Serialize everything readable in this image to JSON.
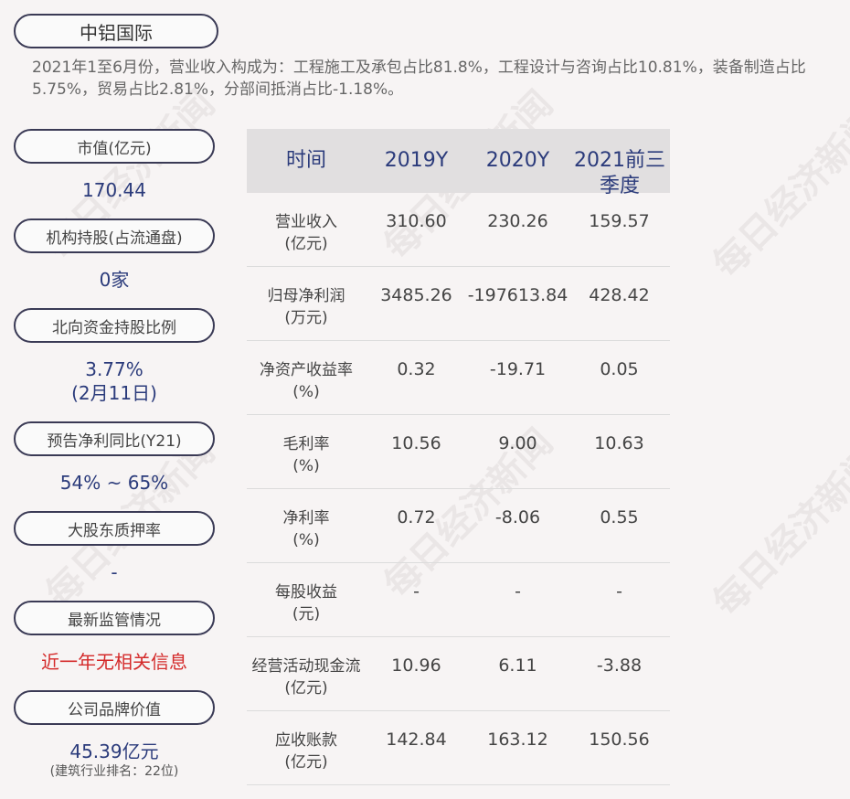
{
  "title": "中铝国际",
  "summary": "2021年1至6月份，营业收入构成为：工程施工及承包占比81.8%，工程设计与咨询占比10.81%，装备制造占比5.75%，贸易占比2.81%，分部间抵消占比-1.18%。",
  "side": {
    "market_cap_label": "市值(亿元)",
    "market_cap_value": "170.44",
    "institution_label": "机构持股(占流通盘)",
    "institution_value": "0家",
    "northbound_label": "北向资金持股比例",
    "northbound_value": "3.77%",
    "northbound_date": "(2月11日)",
    "forecast_label": "预告净利同比(Y21)",
    "forecast_value": "54% ~ 65%",
    "pledge_label": "大股东质押率",
    "pledge_value": "-",
    "regulation_label": "最新监管情况",
    "regulation_value": "近一年无相关信息",
    "brand_label": "公司品牌价值",
    "brand_value": "45.39亿元",
    "brand_rank": "(建筑行业排名：22位)"
  },
  "table": {
    "headers": [
      "时间",
      "2019Y",
      "2020Y",
      "2021前三季度"
    ],
    "rows": [
      {
        "label": "营业收入",
        "unit": "(亿元)",
        "v": [
          "310.60",
          "230.26",
          "159.57"
        ]
      },
      {
        "label": "归母净利润",
        "unit": "(万元)",
        "v": [
          "3485.26",
          "-197613.84",
          "428.42"
        ]
      },
      {
        "label": "净资产收益率",
        "unit": "(%)",
        "v": [
          "0.32",
          "-19.71",
          "0.05"
        ]
      },
      {
        "label": "毛利率",
        "unit": "(%)",
        "v": [
          "10.56",
          "9.00",
          "10.63"
        ]
      },
      {
        "label": "净利率",
        "unit": "(%)",
        "v": [
          "0.72",
          "-8.06",
          "0.55"
        ]
      },
      {
        "label": "每股收益",
        "unit": "(元)",
        "v": [
          "-",
          "-",
          "-"
        ]
      },
      {
        "label": "经营活动现金流",
        "unit": "(亿元)",
        "v": [
          "10.96",
          "6.11",
          "-3.88"
        ]
      },
      {
        "label": "应收账款",
        "unit": "(亿元)",
        "v": [
          "142.84",
          "163.12",
          "150.56"
        ]
      }
    ]
  },
  "watermark": "每日经济新闻"
}
